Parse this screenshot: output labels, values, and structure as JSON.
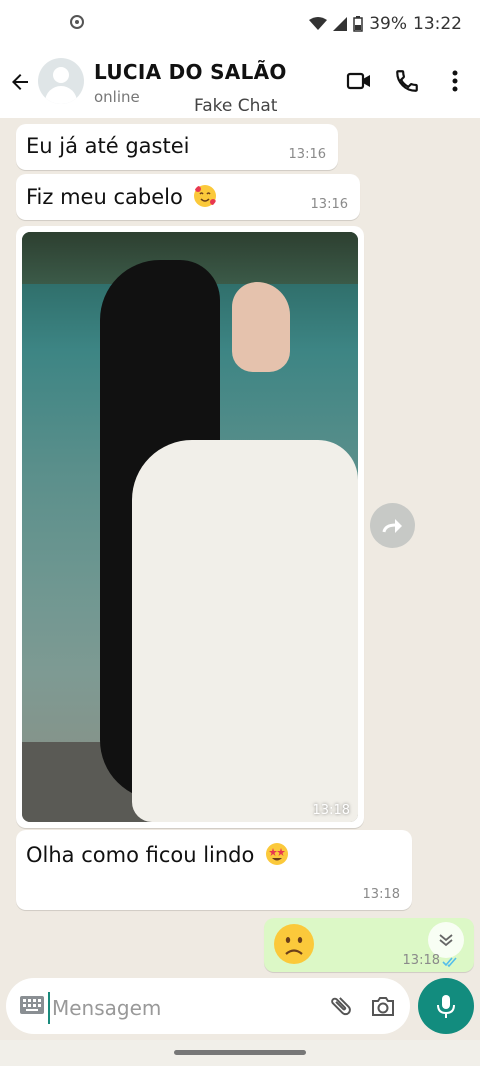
{
  "status_bar": {
    "battery": "39%",
    "time": "13:22"
  },
  "header": {
    "contact_name": "LUCIA DO SALÃO",
    "contact_status": "online",
    "overlay_label": "Fake Chat"
  },
  "messages": [
    {
      "text": "Eu já até gastei",
      "time": "13:16",
      "direction": "incoming"
    },
    {
      "text": "Fiz meu cabelo",
      "emoji": "smiling-face-with-hearts",
      "time": "13:16",
      "direction": "incoming"
    },
    {
      "image": "woman-with-long-black-hair-by-lake",
      "time": "13:18",
      "direction": "incoming"
    },
    {
      "text": "Olha como ficou lindo",
      "emoji": "star-struck",
      "time": "13:18",
      "direction": "incoming"
    },
    {
      "emoji": "slightly-frowning-face",
      "time": "13:18",
      "direction": "outgoing",
      "read": true
    }
  ],
  "composer": {
    "placeholder": "Mensagem"
  },
  "colors": {
    "header_bg": "#ffffff",
    "chat_bg": "#efeae2",
    "incoming_bubble": "#ffffff",
    "outgoing_bubble": "#dcf8c6",
    "accent": "#128c7e",
    "read_ticks": "#53bdeb"
  }
}
